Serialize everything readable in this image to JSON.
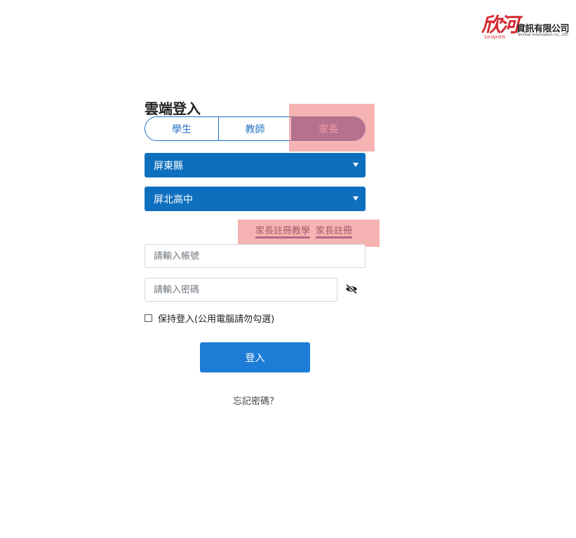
{
  "logo": {
    "mark": "欣河",
    "mark_sub": "SHINHER",
    "company_name": "資訊有限公司",
    "company_en": "Shinher Information Co., LTD."
  },
  "login": {
    "title": "雲端登入",
    "roles": [
      {
        "label": "學生",
        "active": false
      },
      {
        "label": "教師",
        "active": false
      },
      {
        "label": "家長",
        "active": true
      }
    ],
    "county_select": {
      "selected": "屏東縣"
    },
    "school_select": {
      "selected": "屏北高中"
    },
    "links": {
      "tutorial": "家長註冊教學",
      "register": "家長註冊"
    },
    "account_input": {
      "placeholder": "請輸入帳號",
      "value": ""
    },
    "password_input": {
      "placeholder": "請輸入密碼",
      "value": ""
    },
    "remember_label": "保持登入(公用電腦請勿勾選)",
    "remember_checked": false,
    "login_button": "登入",
    "forgot_password": "忘記密碼？"
  },
  "icons": {
    "password_toggle": "eye-slash-icon",
    "select_caret": "caret-down-icon"
  },
  "colors": {
    "primary": "#1d7cd6",
    "select_bg": "#0f6fbf",
    "active_tab_bg": "#5f5aa2",
    "highlight": "#f08080",
    "brand_red": "#d3262c"
  }
}
